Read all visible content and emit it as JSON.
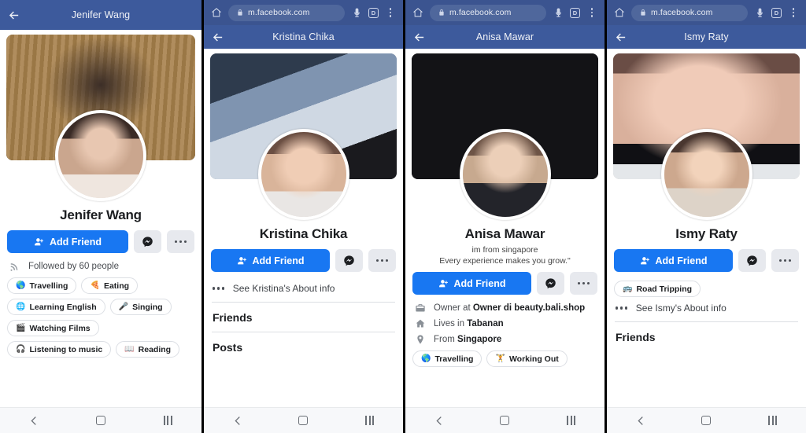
{
  "browser": {
    "url": "m.facebook.com",
    "home_icon": "home-icon",
    "lock_icon": "lock-icon",
    "mic_icon": "microphone-icon",
    "tab_count": "D",
    "menu_icon": "kebab-menu-icon"
  },
  "android_nav": {
    "back": "back-icon",
    "home": "home-square-icon",
    "recents": "recents-icon"
  },
  "common": {
    "add_friend_label": "Add Friend",
    "messenger_label": "messenger-icon",
    "more_label": "more-options-icon",
    "accent_blue": "#1877f2",
    "header_blue": "#3d5a9c",
    "chrome_blue": "#3b5490"
  },
  "panels": [
    {
      "id": "panel-jenifer-wang",
      "has_browser_chrome": false,
      "title": "Jenifer Wang",
      "name": "Jenifer Wang",
      "bio": "",
      "followers": "Followed by 60 people",
      "followers_icon": "rss-follow-icon",
      "see_about": "",
      "info_rows": [],
      "chips": [
        {
          "emoji": "🌎",
          "label": "Travelling"
        },
        {
          "emoji": "🍕",
          "label": "Eating"
        },
        {
          "emoji": "🌐",
          "label": "Learning English"
        },
        {
          "emoji": "🎤",
          "label": "Singing"
        },
        {
          "emoji": "🎬",
          "label": "Watching Films"
        },
        {
          "emoji": "🎧",
          "label": "Listening to music"
        },
        {
          "emoji": "📖",
          "label": "Reading"
        }
      ],
      "sections": []
    },
    {
      "id": "panel-kristina-chika",
      "has_browser_chrome": true,
      "title": "Kristina Chika",
      "name": "Kristina Chika",
      "bio": "",
      "followers": "",
      "see_about": "See Kristina's About info",
      "info_rows": [],
      "chips": [],
      "sections": [
        "Friends",
        "Posts"
      ]
    },
    {
      "id": "panel-anisa-mawar",
      "has_browser_chrome": true,
      "title": "Anisa Mawar",
      "name": "Anisa Mawar",
      "bio": "im from singapore\nEvery experience makes you grow.\"",
      "followers": "",
      "see_about": "",
      "info_rows": [
        {
          "icon": "briefcase-icon",
          "prefix": "Owner at ",
          "bold": "Owner di beauty.bali.shop",
          "suffix": ""
        },
        {
          "icon": "home-icon",
          "prefix": "Lives in ",
          "bold": "Tabanan",
          "suffix": ""
        },
        {
          "icon": "location-pin-icon",
          "prefix": "From ",
          "bold": "Singapore",
          "suffix": ""
        }
      ],
      "chips": [
        {
          "emoji": "🌎",
          "label": "Travelling"
        },
        {
          "emoji": "🏋️",
          "label": "Working Out"
        }
      ],
      "sections": []
    },
    {
      "id": "panel-ismy-raty",
      "has_browser_chrome": true,
      "title": "Ismy Raty",
      "name": "Ismy Raty",
      "bio": "",
      "followers": "",
      "see_about": "See Ismy's About info",
      "info_rows": [],
      "chips": [
        {
          "emoji": "🚌",
          "label": "Road Tripping"
        }
      ],
      "sections": [
        "Friends"
      ]
    }
  ]
}
